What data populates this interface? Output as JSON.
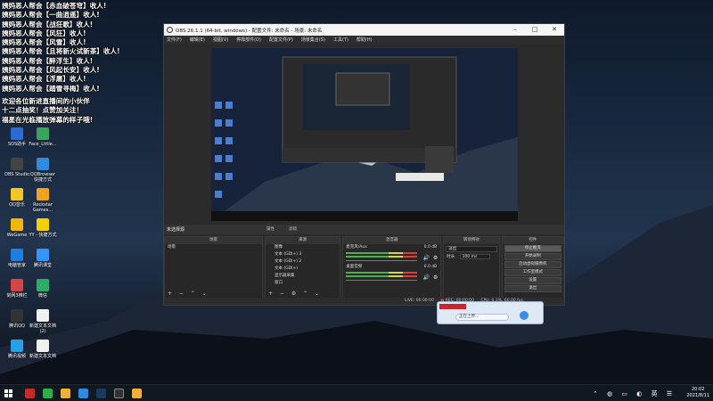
{
  "chat_overlay": {
    "lines": [
      "姨妈恶人帮会【赤血破苍穹】收人!",
      "姨妈恶人帮会【一曲逍遥】收人!",
      "姨妈恶人帮会【战狂歌】收人!",
      "姨妈恶人帮会【风狂】收人!",
      "姨妈恶人帮会【风雪】收人!",
      "姨妈恶人帮会【且将新火试新茶】收人!",
      "姨妈恶人帮会【醉浮生】收人!",
      "姨妈恶人帮会【风起长安】收人!",
      "姨妈恶人帮会【浮屠】收人!",
      "姨妈恶人帮会【踏雪寻梅】收人!",
      "",
      "欢迎各位新进直播间的小伙伴",
      "十二点抽奖！点赞加关注！",
      "福星在光临播放弹幕的样子哦!"
    ]
  },
  "desktop_icons": [
    {
      "label": "SOS助手",
      "color": "#2b6cd4"
    },
    {
      "label": "Face_Little...",
      "color": "#3aa35c"
    },
    {
      "label": "OBS Studio",
      "color": "#444444"
    },
    {
      "label": "QQBrowser 快捷方式",
      "color": "#2f8ae0"
    },
    {
      "label": "QQ音乐",
      "color": "#f3c623"
    },
    {
      "label": "Rockstar Games...",
      "color": "#f0a320"
    },
    {
      "label": "WeGame",
      "color": "#f2b705"
    },
    {
      "label": "YY - 快捷方式",
      "color": "#f5d000"
    },
    {
      "label": "电脑管家",
      "color": "#1f7de0"
    },
    {
      "label": "腾讯课堂",
      "color": "#3296ff"
    },
    {
      "label": "剑网3推栏",
      "color": "#d64545"
    },
    {
      "label": "微信",
      "color": "#2aae67"
    },
    {
      "label": "腾讯QQ",
      "color": "#333333"
    },
    {
      "label": "新建文本文档 (2)",
      "color": "#f0f0f0"
    },
    {
      "label": "腾讯视频",
      "color": "#26a0e6"
    },
    {
      "label": "新建文本文档",
      "color": "#f0f0f0"
    }
  ],
  "obs": {
    "title": "OBS 26.1.1 (64-bit, windows) - 配置文件: 未命名 - 场景: 未命名",
    "menu": [
      "文件(F)",
      "编辑(E)",
      "视图(V)",
      "停靠部件(D)",
      "配置文件(P)",
      "场景集合(S)",
      "工具(T)",
      "帮助(H)"
    ],
    "scene_bar": {
      "label": "未选择源",
      "props": "属性",
      "filters": "滤镜"
    },
    "docks": {
      "scenes": {
        "title": "场景",
        "items": [
          "场景"
        ]
      },
      "sources": {
        "title": "来源",
        "items": [
          "图像",
          "文本 (GDI+) 3",
          "文本 (GDI+) 2",
          "文本 (GDI+)",
          "显示器采集",
          "窗口"
        ]
      },
      "mixer": {
        "title": "混音器",
        "channels": [
          {
            "name": "麦克风/Aux",
            "level": "0.0 dB"
          },
          {
            "name": "桌面音频",
            "level": "0.0 dB"
          }
        ]
      },
      "transitions": {
        "title": "转场特效",
        "type": "淡出",
        "duration_label": "时长",
        "duration": "300 ms"
      },
      "controls": {
        "title": "控件",
        "buttons": [
          "停止推流",
          "开始录制",
          "启动虚拟摄像机",
          "工作室模式",
          "设置",
          "退出"
        ]
      }
    },
    "status": {
      "live": "LIVE: 00:00:00",
      "rec": "REC: 00:00:00",
      "cpu": "CPU: 0.3%, 60.00 fps"
    }
  },
  "popup": {
    "text": "正在上传..."
  },
  "taskbar": {
    "time": "20:02",
    "date": "2021/8/11"
  }
}
